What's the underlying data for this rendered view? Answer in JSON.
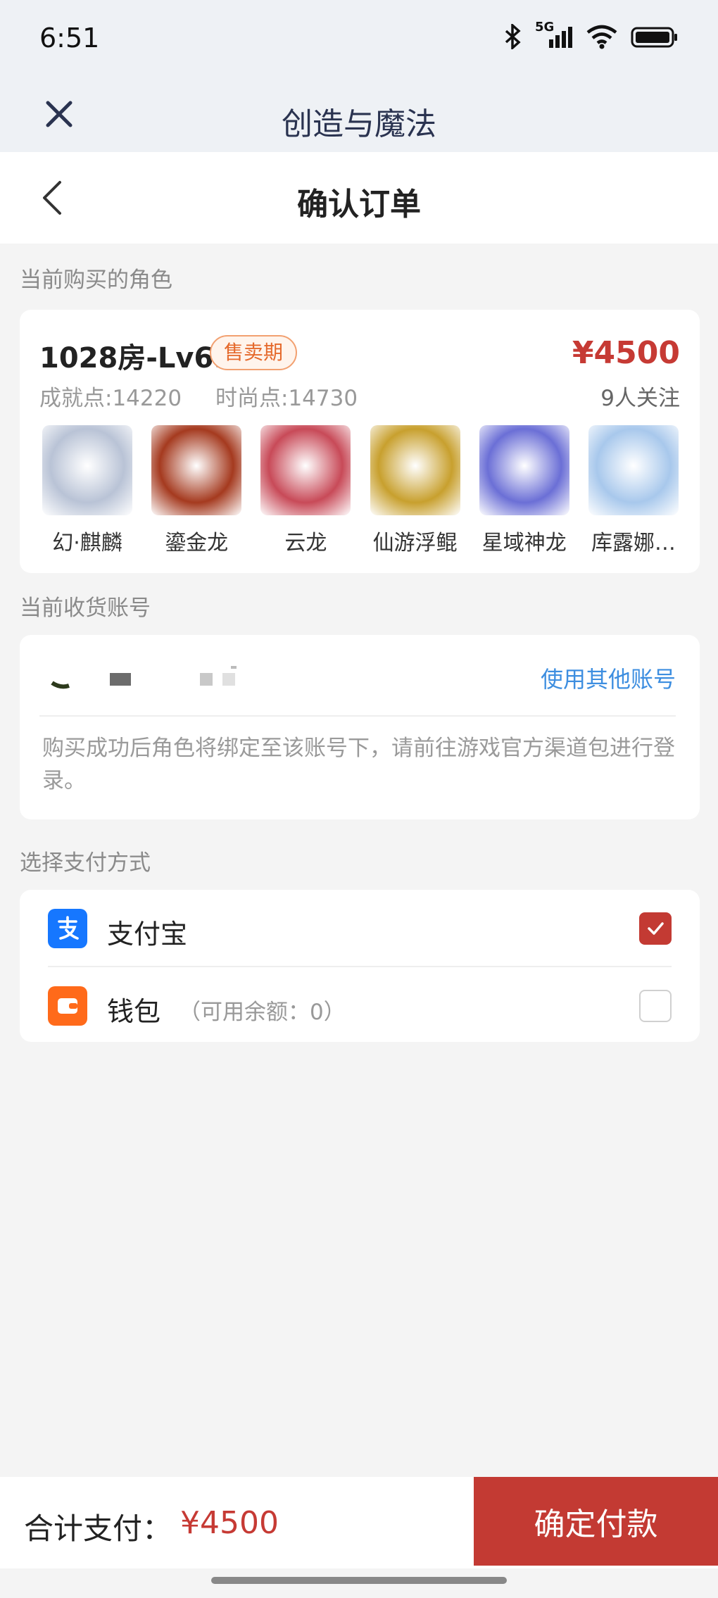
{
  "status": {
    "time": "6:51",
    "network": "5G"
  },
  "miniapp": {
    "title": "创造与魔法"
  },
  "nav": {
    "title": "确认订单"
  },
  "role_section": {
    "label": "当前购买的角色",
    "room": "1028房-Lv69",
    "badge": "售卖期",
    "price": "¥4500",
    "achievement": "成就点:14220",
    "fashion": "时尚点:14730",
    "followers": "9人关注",
    "characters": [
      {
        "name": "幻·麒麟",
        "color": "#b9c3d6"
      },
      {
        "name": "鎏金龙",
        "color": "#a53a1f"
      },
      {
        "name": "云龙",
        "color": "#c84a58"
      },
      {
        "name": "仙游浮鲲",
        "color": "#c8a02e"
      },
      {
        "name": "星域神龙",
        "color": "#6b6fd6"
      },
      {
        "name": "库露娜…",
        "color": "#a8c8ec"
      }
    ]
  },
  "account_section": {
    "label": "当前收货账号",
    "other_account": "使用其他账号",
    "note": "购买成功后角色将绑定至该账号下，请前往游戏官方渠道包进行登录。"
  },
  "payment_section": {
    "label": "选择支付方式",
    "methods": [
      {
        "label": "支付宝",
        "sub": "",
        "checked": true,
        "icon": "alipay-icon",
        "color": "#1677ff"
      },
      {
        "label": "钱包",
        "sub": "（可用余额：0）",
        "checked": false,
        "icon": "wallet-icon",
        "color": "#ff6a1a"
      }
    ]
  },
  "footer": {
    "total_label": "合计支付：",
    "total_price": "¥4500",
    "pay_button": "确定付款"
  },
  "colors": {
    "accent_red": "#c33a33",
    "link_blue": "#3d8ee0",
    "badge_orange": "#e5692b"
  }
}
